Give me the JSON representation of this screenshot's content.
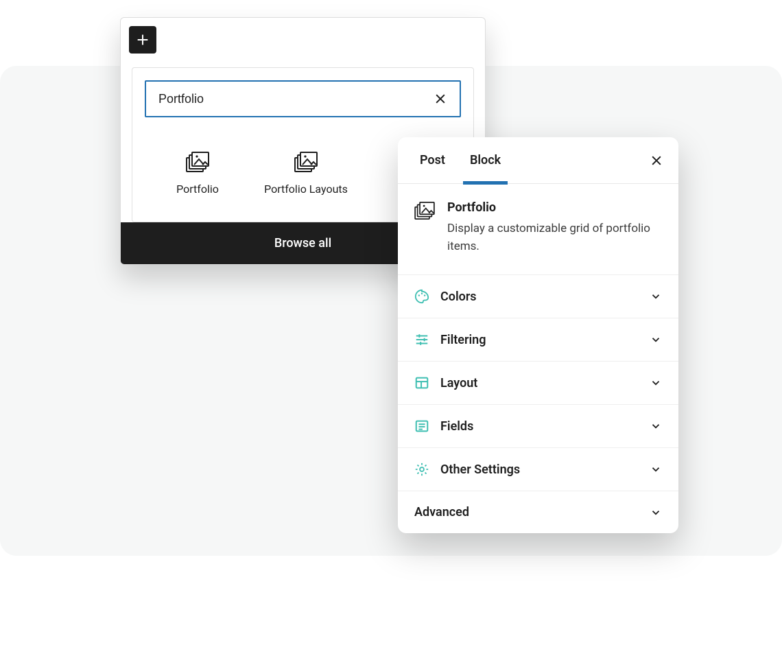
{
  "inserter": {
    "search_value": "Portfolio",
    "results": [
      {
        "label": "Portfolio"
      },
      {
        "label": "Portfolio Layouts"
      }
    ],
    "browse_all": "Browse all"
  },
  "settings": {
    "tabs": {
      "post": "Post",
      "block": "Block",
      "active": "block"
    },
    "block": {
      "title": "Portfolio",
      "description": "Display a customizable grid of portfolio items."
    },
    "sections": [
      {
        "icon": "palette-icon",
        "label": "Colors"
      },
      {
        "icon": "sliders-icon",
        "label": "Filtering"
      },
      {
        "icon": "layout-icon",
        "label": "Layout"
      },
      {
        "icon": "fields-icon",
        "label": "Fields"
      },
      {
        "icon": "gear-icon",
        "label": "Other Settings"
      },
      {
        "icon": "",
        "label": "Advanced"
      }
    ]
  },
  "colors": {
    "accent": "#2271b1",
    "teal": "#3fbfb2",
    "ink": "#1e1e1e"
  }
}
